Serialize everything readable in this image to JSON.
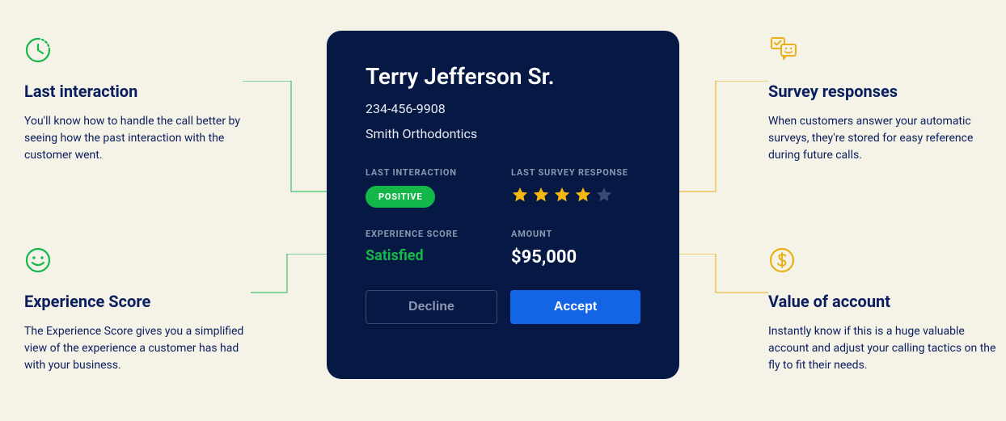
{
  "features": {
    "last_interaction": {
      "title": "Last interaction",
      "body": "You'll know how to handle the call better by seeing how the past interaction with the customer went."
    },
    "experience_score": {
      "title": "Experience Score",
      "body": "The Experience Score gives you a simplified view of the experience a customer has had with your business."
    },
    "survey_responses": {
      "title": "Survey responses",
      "body": "When customers answer your automatic surveys, they're stored for easy reference during future calls."
    },
    "value_account": {
      "title": "Value of account",
      "body": "Instantly know if this is a huge valuable account and adjust your calling tactics on the fly to fit their needs."
    }
  },
  "card": {
    "name": "Terry Jefferson Sr.",
    "phone": "234-456-9908",
    "company": "Smith Orthodontics",
    "labels": {
      "last_interaction": "LAST INTERACTION",
      "last_survey": "LAST SURVEY RESPONSE",
      "experience_score": "EXPERIENCE SCORE",
      "amount": "AMOUNT"
    },
    "interaction_badge": "POSITIVE",
    "score": "Satisfied",
    "amount": "$95,000",
    "survey_rating": 4,
    "survey_max": 5,
    "buttons": {
      "decline": "Decline",
      "accept": "Accept"
    }
  },
  "colors": {
    "green": "#14b84a",
    "yellow": "#e8b019",
    "navy": "#061844",
    "blue": "#1465e6",
    "text_navy": "#0a1e5e"
  }
}
